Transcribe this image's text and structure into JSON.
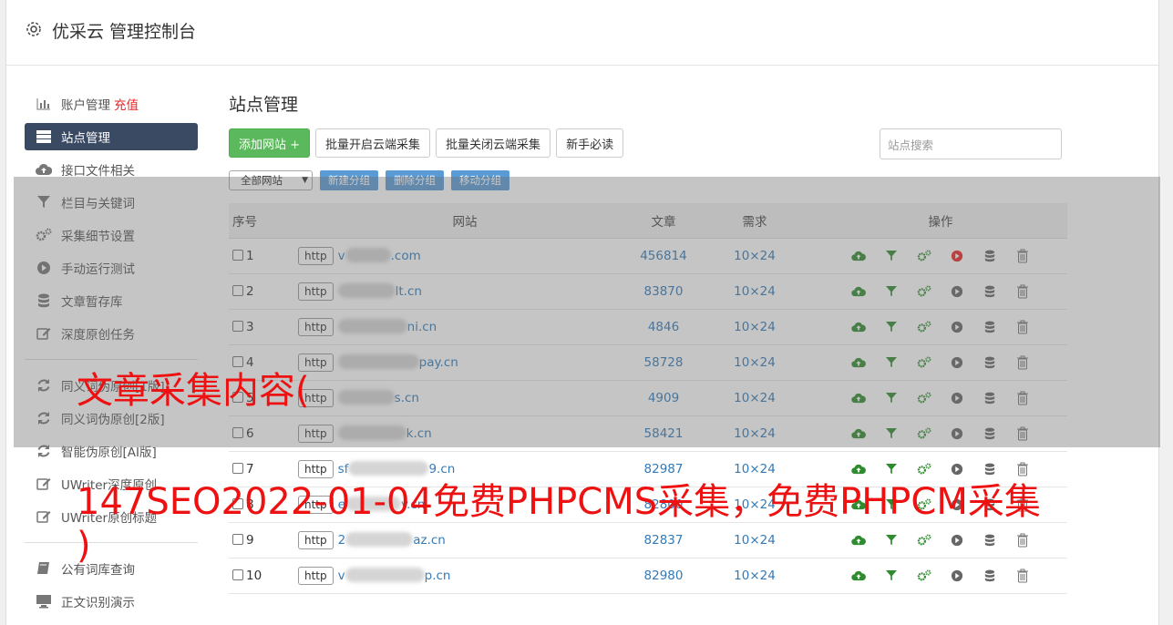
{
  "app": {
    "title": "优采云 管理控制台"
  },
  "sidebar": {
    "items": [
      {
        "label": "账户管理",
        "extra": "充值",
        "icon": "bar-chart-icon"
      },
      {
        "label": "站点管理",
        "icon": "server-icon",
        "active": true
      },
      {
        "label": "接口文件相关",
        "icon": "cloud-upload-icon"
      },
      {
        "label": "栏目与关键词",
        "icon": "filter-icon"
      },
      {
        "label": "采集细节设置",
        "icon": "gears-icon"
      },
      {
        "label": "手动运行测试",
        "icon": "play-circle-icon"
      },
      {
        "label": "文章暂存库",
        "icon": "database-icon"
      },
      {
        "label": "深度原创任务",
        "icon": "edit-icon"
      }
    ],
    "items2": [
      {
        "label": "同义词伪原创[1版]",
        "icon": "refresh-icon"
      },
      {
        "label": "同义词伪原创[2版]",
        "icon": "refresh-icon"
      },
      {
        "label": "智能伪原创[AI版]",
        "icon": "refresh-icon"
      },
      {
        "label": "UWriter深度原创",
        "icon": "edit-icon"
      },
      {
        "label": "UWriter原创标题",
        "icon": "edit-icon"
      }
    ],
    "items3": [
      {
        "label": "公有词库查询",
        "icon": "book-icon"
      },
      {
        "label": "正文识别演示",
        "icon": "monitor-icon"
      }
    ]
  },
  "main": {
    "heading": "站点管理",
    "buttons": {
      "add": "添加网站 +",
      "batch_open": "批量开启云端采集",
      "batch_close": "批量关闭云端采集",
      "newbie": "新手必读"
    },
    "search_placeholder": "站点搜索",
    "group_select": "全部网站",
    "group_buttons": {
      "new": "新建分组",
      "delete": "删除分组",
      "move": "移动分组"
    },
    "columns": {
      "seq": "序号",
      "site": "网站",
      "articles": "文章",
      "demand": "需求",
      "ops": "操作"
    },
    "rows": [
      {
        "seq": "1",
        "proto": "http",
        "prefix": "v",
        "suffix": ".com",
        "articles": "456814",
        "demand": "10×24",
        "active": true
      },
      {
        "seq": "2",
        "proto": "http",
        "prefix": "",
        "suffix": "lt.cn",
        "articles": "83870",
        "demand": "10×24"
      },
      {
        "seq": "3",
        "proto": "http",
        "prefix": "",
        "suffix": "ni.cn",
        "articles": "4846",
        "demand": "10×24"
      },
      {
        "seq": "4",
        "proto": "http",
        "prefix": "",
        "suffix": "pay.cn",
        "articles": "58728",
        "demand": "10×24"
      },
      {
        "seq": "5",
        "proto": "http",
        "prefix": "",
        "suffix": "s.cn",
        "articles": "4909",
        "demand": "10×24"
      },
      {
        "seq": "6",
        "proto": "http",
        "prefix": "",
        "suffix": "k.cn",
        "articles": "58421",
        "demand": "10×24"
      },
      {
        "seq": "7",
        "proto": "http",
        "prefix": "sf",
        "suffix": "9.cn",
        "articles": "82987",
        "demand": "10×24"
      },
      {
        "seq": "8",
        "proto": "http",
        "prefix": "e",
        "suffix": "y.cn",
        "articles": "82800",
        "demand": "10×24"
      },
      {
        "seq": "9",
        "proto": "http",
        "prefix": "2",
        "suffix": "az.cn",
        "articles": "82837",
        "demand": "10×24"
      },
      {
        "seq": "10",
        "proto": "http",
        "prefix": "v",
        "suffix": "p.cn",
        "articles": "82980",
        "demand": "10×24"
      }
    ]
  },
  "watermark": {
    "line1": "文章采集内容(",
    "line2": "147SEO2022-01-04免费PHPCMS采集，免费PHPCM采集",
    "line3": ")",
    "color": "#ee1111"
  }
}
